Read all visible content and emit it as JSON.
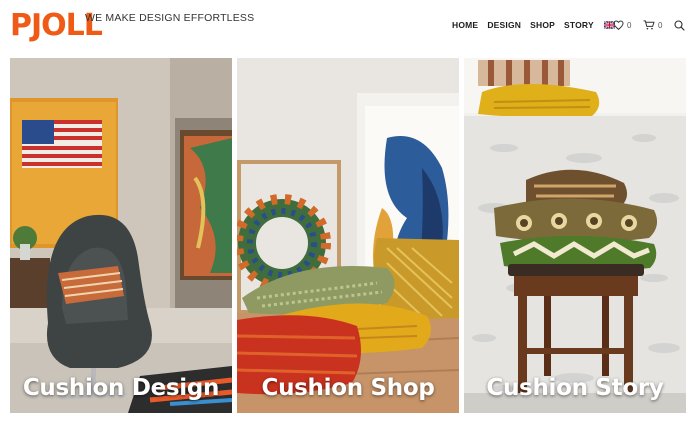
{
  "brand": {
    "logo": "PJOLL",
    "tagline": "WE MAKE DESIGN EFFORTLESS",
    "color": "#ef5a16"
  },
  "nav": {
    "items": [
      {
        "label": "HOME"
      },
      {
        "label": "DESIGN"
      },
      {
        "label": "SHOP"
      },
      {
        "label": "STORY"
      }
    ],
    "language_icon": "uk-flag-icon"
  },
  "header_icons": {
    "wishlist": {
      "icon": "heart-icon",
      "count": "0"
    },
    "cart": {
      "icon": "cart-icon",
      "count": "0"
    },
    "search": {
      "icon": "search-icon"
    }
  },
  "tiles": [
    {
      "title": "Cushion Design",
      "image": "living room with grey egg chair and flag painting"
    },
    {
      "title": "Cushion Shop",
      "image": "stack of colorful cushions on wooden floor"
    },
    {
      "title": "Cushion Story",
      "image": "patterned cushions stacked on a wooden stool against whitewashed wall"
    }
  ]
}
